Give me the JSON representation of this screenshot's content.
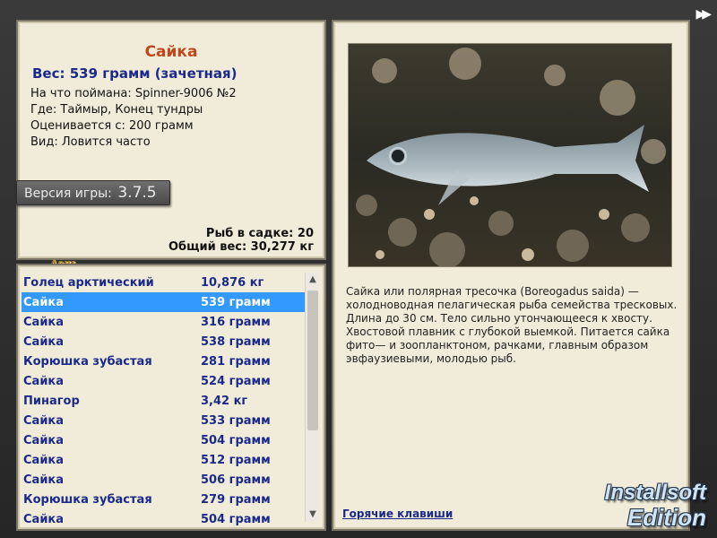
{
  "info": {
    "title": "Сайка",
    "weight_line": "Вес: 539 грамм (зачетная)",
    "caught_with": "На что поймана: Spinner-9006 №2",
    "where": "Где: Таймыр, Конец тундры",
    "valued_from": "Оценивается с: 200 грамм",
    "species": "Вид: Ловится часто",
    "version_label": "Версия игры:",
    "version": "3.7.5",
    "logo": "Aень",
    "fish_in_keepnet": "Рыб в садке: 20",
    "total_weight": "Общий вес: 30,277 кг"
  },
  "list": {
    "items": [
      {
        "name": "Голец арктический",
        "weight": "10,876 кг"
      },
      {
        "name": "Сайка",
        "weight": "539 грамм",
        "selected": true
      },
      {
        "name": "Сайка",
        "weight": "316 грамм"
      },
      {
        "name": "Сайка",
        "weight": "538 грамм"
      },
      {
        "name": "Корюшка зубастая",
        "weight": "281 грамм"
      },
      {
        "name": "Сайка",
        "weight": "524 грамм"
      },
      {
        "name": "Пинагор",
        "weight": "3,42 кг"
      },
      {
        "name": "Сайка",
        "weight": "533 грамм"
      },
      {
        "name": "Сайка",
        "weight": "504 грамм"
      },
      {
        "name": "Сайка",
        "weight": "512 грамм"
      },
      {
        "name": "Сайка",
        "weight": "506 грамм"
      },
      {
        "name": "Корюшка зубастая",
        "weight": "279 грамм"
      },
      {
        "name": "Сайка",
        "weight": "504 грамм"
      }
    ]
  },
  "details": {
    "description": "Сайка или полярная тресочка (Boreogadus saida) — холодноводная пелагическая рыба семейства тресковых. Длина до 30 см. Тело сильно утончающееся к хвосту. Хвостовой плавник с глубокой выемкой. Питается сайка фито— и зоопланктоном, рачками, главным образом эвфаузиевыми, молодью рыб.",
    "hotkeys": "Горячие клавиши"
  },
  "watermark": {
    "line1": "Installsoft",
    "line2": "Edition"
  },
  "colors": {
    "accent_title": "#c0471b",
    "text_blue": "#1b2a8a",
    "selection": "#3399ff",
    "panel_bg": "#f1ecd9"
  }
}
